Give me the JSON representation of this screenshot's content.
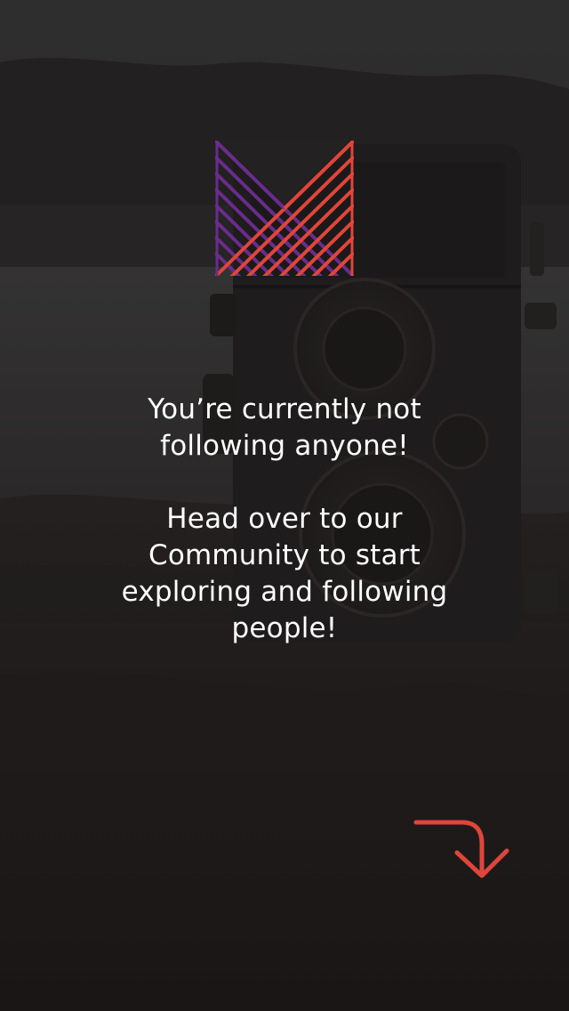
{
  "empty_state": {
    "line1": "You’re currently not following anyone!",
    "line2": "Head over to our Community to start exploring and following people!"
  },
  "icons": {
    "logo": "m-logo-icon",
    "arrow": "curved-arrow-down-icon"
  },
  "colors": {
    "logo_purple": "#6a2c8c",
    "logo_red": "#e0453a",
    "arrow": "#e0453a",
    "text": "#ffffff"
  }
}
